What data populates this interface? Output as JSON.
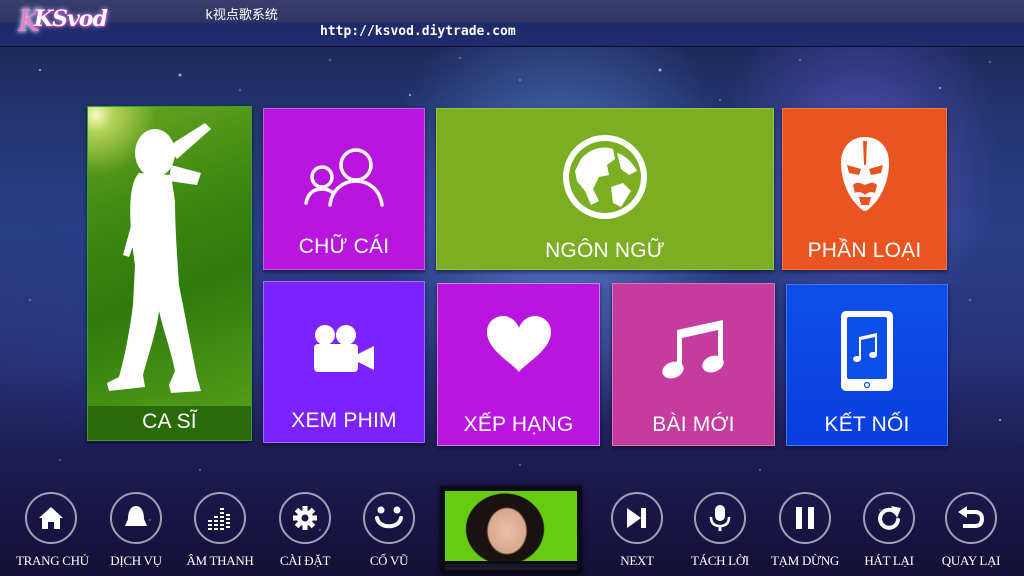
{
  "header": {
    "logo": "KSvod",
    "title": "k视点歌系统",
    "url": "http://ksvod.diytrade.com"
  },
  "tiles": {
    "singer": {
      "label": "CA SĨ",
      "icon": "singer-silhouette-icon",
      "color": "#3f8a12"
    },
    "letters": {
      "label": "CHỮ CÁI",
      "icon": "users-icon",
      "color": "#b816de"
    },
    "language": {
      "label": "NGÔN NGỮ",
      "icon": "globe-icon",
      "color": "#7cae24"
    },
    "category": {
      "label": "PHẦN LOẠI",
      "icon": "opera-mask-icon",
      "color": "#ea5420"
    },
    "movies": {
      "label": "XEM PHIM",
      "icon": "video-camera-icon",
      "color": "#7b22ff"
    },
    "ranking": {
      "label": "XẾP HẠNG",
      "icon": "heart-icon",
      "color": "#b816de"
    },
    "new_songs": {
      "label": "BÀI MỚI",
      "icon": "music-note-icon",
      "color": "#c63b9e"
    },
    "connect": {
      "label": "KẾT NỐI",
      "icon": "phone-music-icon",
      "color": "#0c4ee8"
    }
  },
  "controls": {
    "left": [
      {
        "label": "TRANG CHỦ",
        "icon": "home-icon"
      },
      {
        "label": "DỊCH VỤ",
        "icon": "bell-icon"
      },
      {
        "label": "ÂM THANH",
        "icon": "equalizer-icon"
      },
      {
        "label": "CÀI ĐẶT",
        "icon": "gear-icon"
      },
      {
        "label": "CỔ VŨ",
        "icon": "smiley-icon"
      }
    ],
    "right": [
      {
        "label": "NEXT",
        "icon": "skip-next-icon"
      },
      {
        "label": "TÁCH LỜI",
        "icon": "microphone-icon"
      },
      {
        "label": "TẠM DỪNG",
        "icon": "pause-icon"
      },
      {
        "label": "HÁT LẠI",
        "icon": "replay-icon"
      },
      {
        "label": "QUAY LẠI",
        "icon": "back-icon"
      }
    ]
  },
  "preview": {
    "description": "video-preview-thumbnail"
  }
}
